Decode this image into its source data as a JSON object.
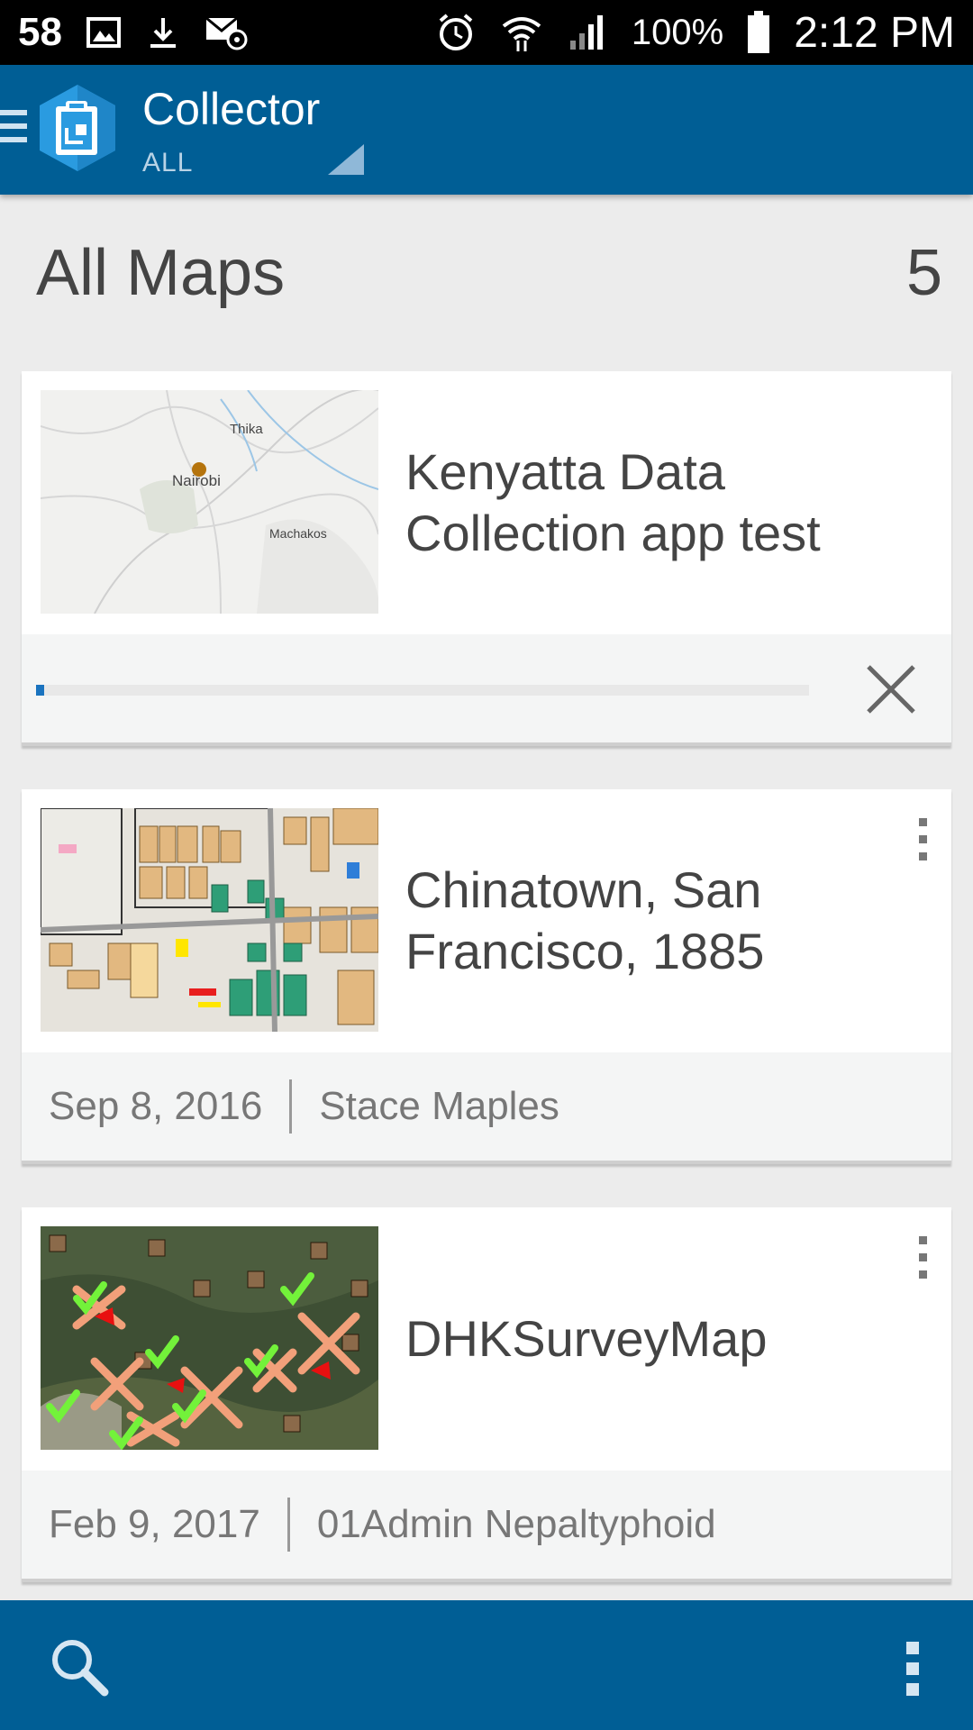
{
  "status_bar": {
    "notification_count": "58",
    "battery_percent": "100%",
    "time": "2:12 PM",
    "left_icons": [
      "image-icon",
      "download-icon",
      "email-at-icon"
    ],
    "right_icons": [
      "alarm-icon",
      "wifi-icon",
      "signal-icon",
      "battery-icon"
    ]
  },
  "app_bar": {
    "title": "Collector",
    "filter": "ALL",
    "background_color": "#005e95"
  },
  "section": {
    "title": "All Maps",
    "count": "5"
  },
  "maps": [
    {
      "title": "Kenyatta Data Collection app test",
      "thumbnail": "nairobi-basemap",
      "map_labels": [
        "Thika",
        "Nairobi",
        "Machakos"
      ],
      "download_progress": 0.01,
      "state": "downloading"
    },
    {
      "title": "Chinatown, San Francisco, 1885",
      "thumbnail": "chinatown-parcel-map",
      "date": "Sep 8, 2016",
      "owner": "Stace Maples"
    },
    {
      "title": "DHKSurveyMap",
      "thumbnail": "survey-satellite-map",
      "date": "Feb 9, 2017",
      "owner": "01Admin Nepaltyphoid"
    }
  ],
  "bottom_bar": {
    "search_icon": "search-icon",
    "overflow_icon": "overflow-menu-icon"
  }
}
